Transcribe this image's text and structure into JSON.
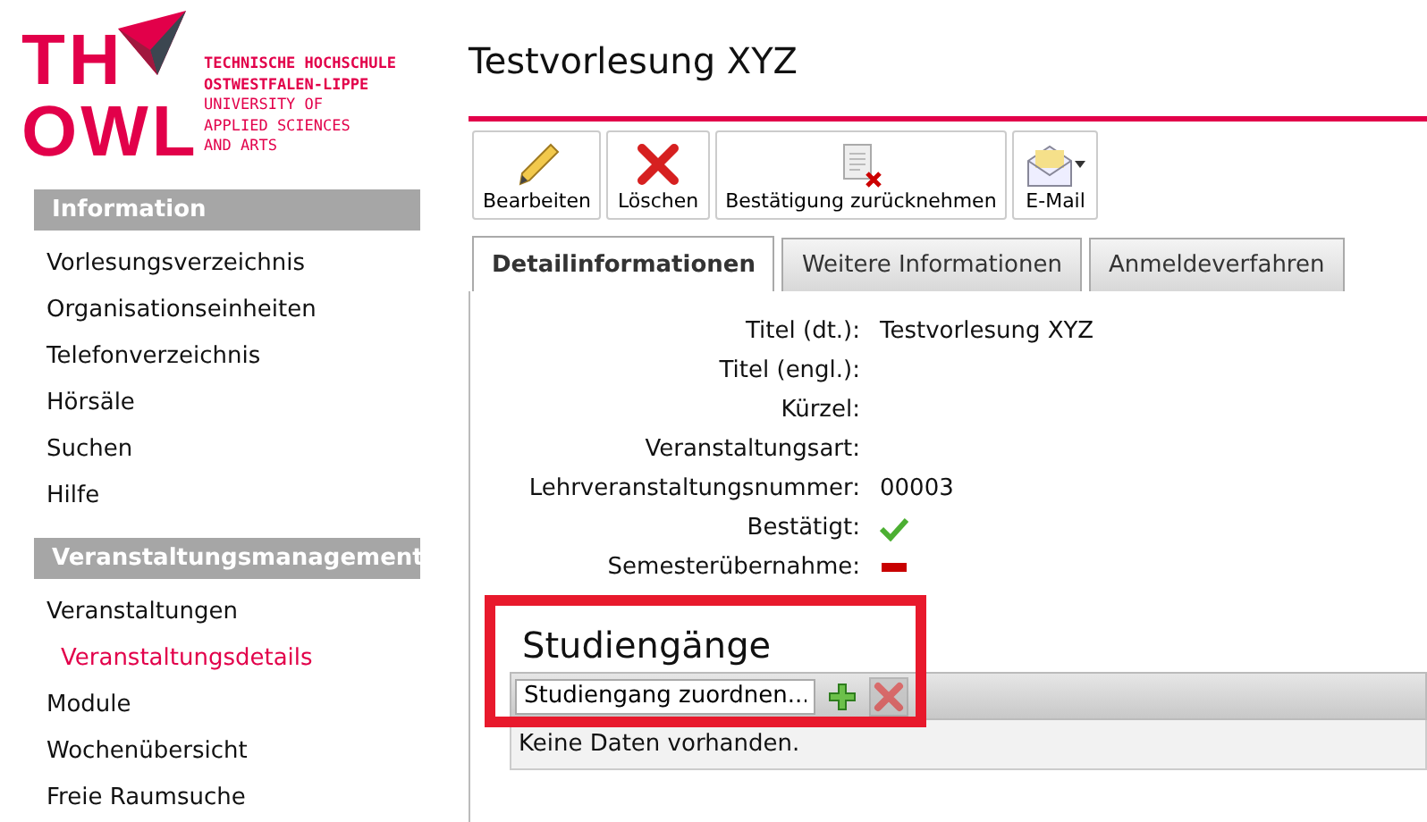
{
  "logo": {
    "mark_top": "TH",
    "mark_bottom": "OWL",
    "lines": [
      {
        "text": "TECHNISCHE HOCHSCHULE",
        "strong": true
      },
      {
        "text": "OSTWESTFALEN-LIPPE",
        "strong": true
      },
      {
        "text": "UNIVERSITY OF",
        "strong": false
      },
      {
        "text": "APPLIED SCIENCES",
        "strong": false
      },
      {
        "text": "AND ARTS",
        "strong": false
      }
    ]
  },
  "sidebar": [
    {
      "title": "Information",
      "items": [
        {
          "label": "Vorlesungsverzeichnis",
          "selected": false
        },
        {
          "label": "Organisationseinheiten",
          "selected": false
        },
        {
          "label": "Telefonverzeichnis",
          "selected": false
        },
        {
          "label": "Hörsäle",
          "selected": false
        },
        {
          "label": "Suchen",
          "selected": false
        },
        {
          "label": "Hilfe",
          "selected": false
        }
      ]
    },
    {
      "title": "Veranstaltungsmanagement",
      "items": [
        {
          "label": "Veranstaltungen",
          "selected": false,
          "children": [
            {
              "label": "Veranstaltungsdetails",
              "selected": true
            }
          ]
        },
        {
          "label": "Module",
          "selected": false
        },
        {
          "label": "Wochenübersicht",
          "selected": false
        },
        {
          "label": "Freie Raumsuche",
          "selected": false
        }
      ]
    }
  ],
  "page_title": "Testvorlesung XYZ",
  "toolbar": [
    {
      "kind": "edit",
      "label": "Bearbeiten"
    },
    {
      "kind": "delete",
      "label": "Löschen"
    },
    {
      "kind": "revoke",
      "label": "Bestätigung zurücknehmen"
    },
    {
      "kind": "mail",
      "label": "E-Mail"
    }
  ],
  "tabs": [
    {
      "label": "Detailinformationen",
      "selected": true
    },
    {
      "label": "Weitere Informationen",
      "selected": false
    },
    {
      "label": "Anmeldeverfahren",
      "selected": false
    }
  ],
  "details": [
    {
      "label": "Titel (dt.):",
      "kind": "text",
      "value": "Testvorlesung XYZ"
    },
    {
      "label": "Titel (engl.):",
      "kind": "text"
    },
    {
      "label": "Kürzel:",
      "kind": "text"
    },
    {
      "label": "Veranstaltungsart:",
      "kind": "text"
    },
    {
      "label": "Lehrveranstaltungsnummer:",
      "kind": "text",
      "value": "00003"
    },
    {
      "label": "Bestätigt:",
      "kind": "flag",
      "on": true
    },
    {
      "label": "Semesterübernahme:",
      "kind": "flag",
      "on": false
    }
  ],
  "studiengaenge": {
    "title": "Studiengänge",
    "assign_field": {
      "value": "Studiengang zuordnen..."
    },
    "add_disabled": false,
    "remove_disabled": true,
    "empty_text": "Keine Daten vorhanden."
  }
}
